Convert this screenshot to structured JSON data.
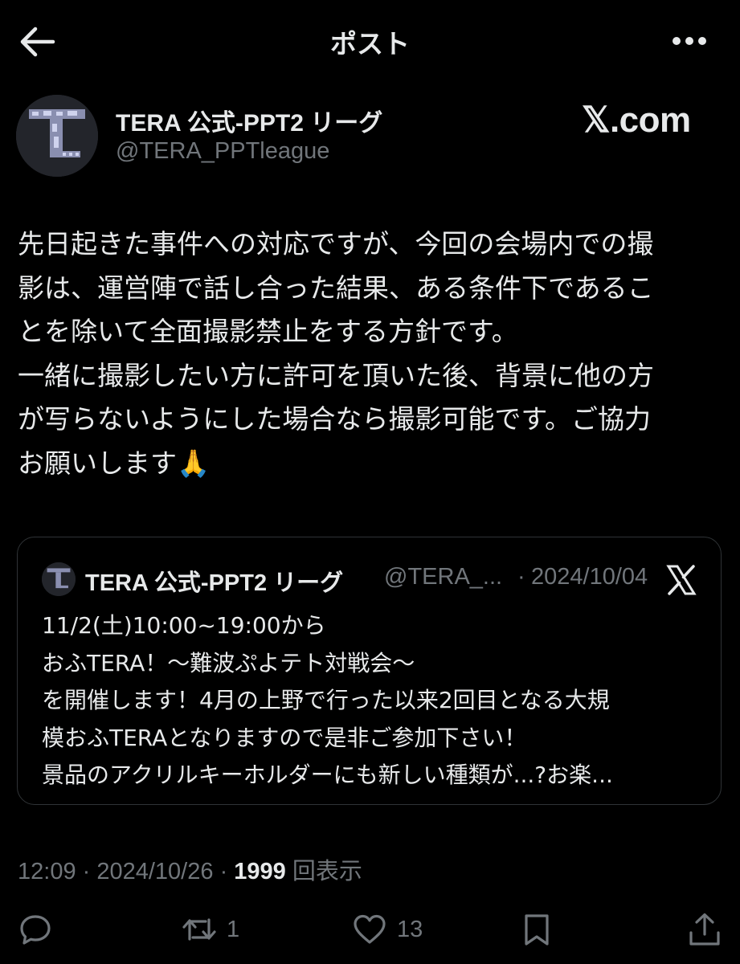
{
  "header": {
    "title": "ポスト",
    "back_icon": "arrow-left-icon",
    "more_icon": "more-horizontal-icon"
  },
  "author": {
    "display_name": "TERA 公式-PPT2 リーグ",
    "handle": "@TERA_PPTleague"
  },
  "watermark": "𝕏.com",
  "post": {
    "lines": [
      "先日起きた事件への対応ですが、今回の会場内での撮",
      "影は、運営陣で話し合った結果、ある条件下であるこ",
      "とを除いて全面撮影禁止をする方針です。",
      "一緒に撮影したい方に許可を頂いた後、背景に他の方",
      "が写らないようにした場合なら撮影可能です。ご協力",
      "お願いします🙏"
    ]
  },
  "quote": {
    "display_name": "TERA 公式-PPT2 リーグ",
    "handle": "@TERA_...",
    "separator": "·",
    "date": "2024/10/04",
    "lines": [
      "11/2(土)10:00~19:00から",
      "おふTERA！～難波ぷよテト対戦会～",
      "を開催します！4月の上野で行った以来2回目となる大規",
      "模おふTERAとなりますので是非ご参加下さい！",
      "景品のアクリルキーホルダーにも新しい種類が...?お楽..."
    ]
  },
  "meta": {
    "time": "12:09",
    "sep1": " · ",
    "date": "2024/10/26",
    "sep2": " · ",
    "views": "1999",
    "views_label": " 回表示"
  },
  "actions": {
    "reply_count": "",
    "repost_count": "1",
    "like_count": "13"
  },
  "colors": {
    "background": "#000000",
    "text_primary": "#e7e9ea",
    "text_secondary": "#71767b",
    "border": "#2f3336"
  }
}
